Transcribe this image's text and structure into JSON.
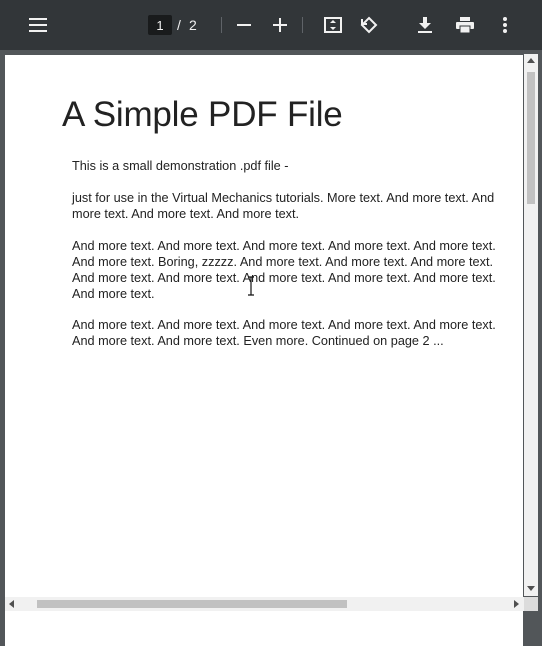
{
  "toolbar": {
    "menu_icon": "hamburger-menu-icon",
    "current_page": "1",
    "page_separator": "/",
    "total_pages": "2",
    "zoom_out_icon": "minus-icon",
    "zoom_in_icon": "plus-icon",
    "fit_icon": "fit-to-page-icon",
    "rotate_icon": "rotate-counterclockwise-icon",
    "download_icon": "download-icon",
    "print_icon": "print-icon",
    "more_icon": "more-vertical-icon"
  },
  "document": {
    "title": "A Simple PDF File",
    "paragraphs": [
      "This is a small demonstration .pdf file -",
      "just for use in the Virtual Mechanics tutorials. More text. And more text. And more text. And more text. And more text.",
      "And more text. And more text. And more text. And more text. And more text. And more text. Boring, zzzzz. And more text. And more text. And more text. And more text. And more text. And more text. And more text. And more text. And more text.",
      "And more text. And more text. And more text. And more text. And more text. And more text. And more text. Even more. Continued on page 2 ..."
    ]
  },
  "colors": {
    "toolbar_bg": "#323639",
    "viewer_bg": "#525659",
    "page_bg": "#ffffff"
  }
}
